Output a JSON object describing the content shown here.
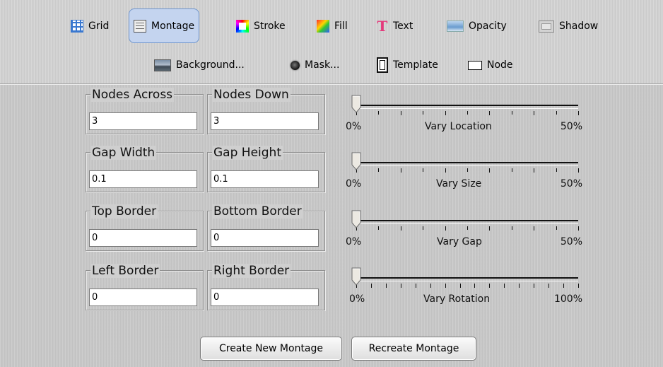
{
  "toolbar": {
    "row1": [
      {
        "label": "Grid",
        "icon": "grid-icon"
      },
      {
        "label": "Montage",
        "icon": "montage-icon",
        "active": true
      },
      {
        "label": "Stroke",
        "icon": "stroke-icon"
      },
      {
        "label": "Fill",
        "icon": "fill-icon"
      },
      {
        "label": "Text",
        "icon": "text-icon"
      },
      {
        "label": "Opacity",
        "icon": "opacity-icon"
      },
      {
        "label": "Shadow",
        "icon": "shadow-icon"
      }
    ],
    "row2": [
      {
        "label": "Background...",
        "icon": "background-icon"
      },
      {
        "label": "Mask...",
        "icon": "mask-icon"
      },
      {
        "label": "Template",
        "icon": "template-icon"
      },
      {
        "label": "Node",
        "icon": "node-icon"
      }
    ],
    "text_icon_glyph": "T",
    "active_color": "#c4d4ef"
  },
  "fields": {
    "nodes_across": {
      "legend": "Nodes Across",
      "value": "3"
    },
    "nodes_down": {
      "legend": "Nodes Down",
      "value": "3"
    },
    "gap_width": {
      "legend": "Gap Width",
      "value": "0.1"
    },
    "gap_height": {
      "legend": "Gap Height",
      "value": "0.1"
    },
    "top_border": {
      "legend": "Top Border",
      "value": "0"
    },
    "bottom_border": {
      "legend": "Bottom Border",
      "value": "0"
    },
    "left_border": {
      "legend": "Left Border",
      "value": "0"
    },
    "right_border": {
      "legend": "Right Border",
      "value": "0"
    }
  },
  "sliders": {
    "vary_location": {
      "label": "Vary Location",
      "min_label": "0%",
      "max_label": "50%",
      "value": 0,
      "ticks": 11
    },
    "vary_size": {
      "label": "Vary Size",
      "min_label": "0%",
      "max_label": "50%",
      "value": 0,
      "ticks": 11
    },
    "vary_gap": {
      "label": "Vary Gap",
      "min_label": "0%",
      "max_label": "50%",
      "value": 0,
      "ticks": 11
    },
    "vary_rotation": {
      "label": "Vary Rotation",
      "min_label": "0%",
      "max_label": "100%",
      "value": 0,
      "ticks": 16
    }
  },
  "buttons": {
    "create": "Create New Montage",
    "recreate": "Recreate Montage"
  }
}
